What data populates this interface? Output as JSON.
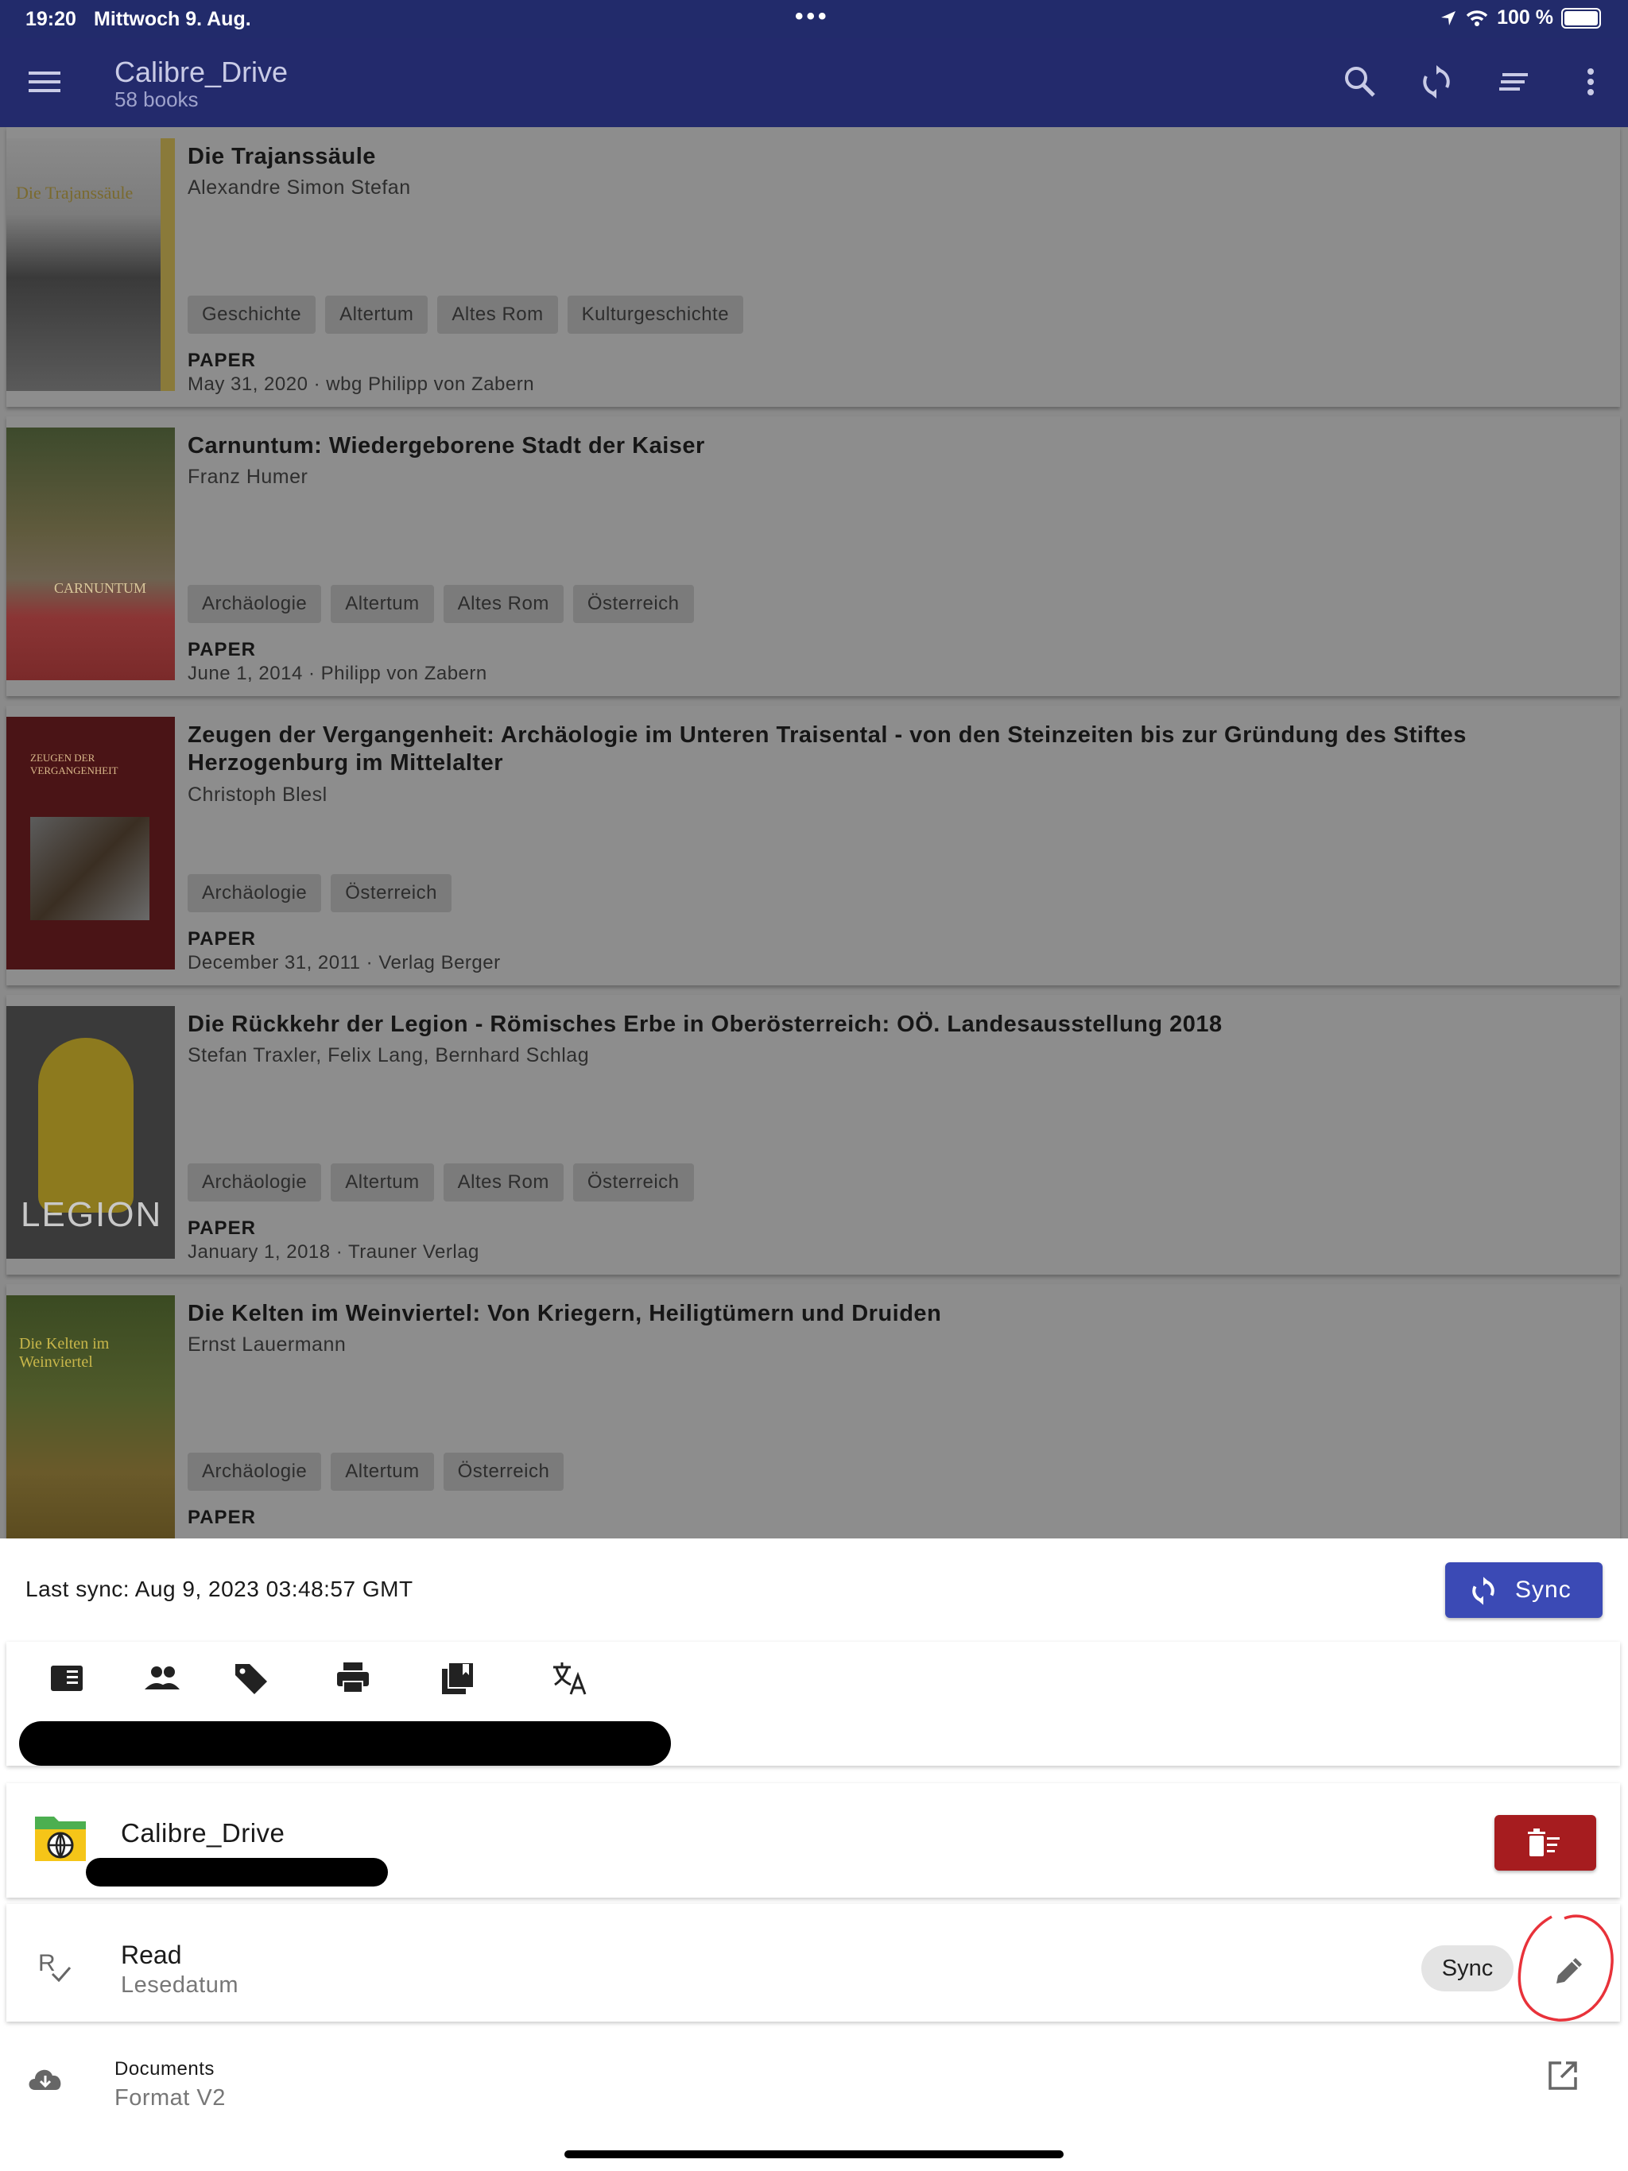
{
  "status_bar": {
    "time": "19:20",
    "date": "Mittwoch 9. Aug.",
    "battery": "100 %"
  },
  "app_bar": {
    "title": "Calibre_Drive",
    "subtitle": "58 books"
  },
  "books": [
    {
      "title": "Die Trajanssäule",
      "author": "Alexandre Simon Stefan",
      "tags": [
        "Geschichte",
        "Altertum",
        "Altes Rom",
        "Kulturgeschichte"
      ],
      "format": "PAPER",
      "published": "May 31, 2020 · wbg Philipp von Zabern",
      "cover_text": "Die Trajanssäule"
    },
    {
      "title": "Carnuntum: Wiedergeborene Stadt der Kaiser",
      "author": "Franz Humer",
      "tags": [
        "Archäologie",
        "Altertum",
        "Altes Rom",
        "Österreich"
      ],
      "format": "PAPER",
      "published": "June 1, 2014 · Philipp von Zabern",
      "cover_text": "CARNUNTUM"
    },
    {
      "title": "Zeugen der Vergangenheit: Archäologie im Unteren Traisental - von den Steinzeiten bis zur Gründung des Stiftes Herzogenburg im Mittelalter",
      "author": "Christoph Blesl",
      "tags": [
        "Archäologie",
        "Österreich"
      ],
      "format": "PAPER",
      "published": "December 31, 2011 · Verlag Berger",
      "cover_text": "ZEUGEN DER VERGANGENHEIT"
    },
    {
      "title": "Die Rückkehr der Legion - Römisches Erbe in Oberösterreich: OÖ. Landesausstellung 2018",
      "author": "Stefan Traxler, Felix Lang, Bernhard Schlag",
      "tags": [
        "Archäologie",
        "Altertum",
        "Altes Rom",
        "Österreich"
      ],
      "format": "PAPER",
      "published": "January 1, 2018 · Trauner Verlag",
      "cover_text": "LEGION"
    },
    {
      "title": "Die Kelten im Weinviertel: Von Kriegern, Heiligtümern und Druiden",
      "author": "Ernst Lauermann",
      "tags": [
        "Archäologie",
        "Altertum",
        "Österreich"
      ],
      "format": "PAPER",
      "published": "",
      "cover_text": "Die Kelten im Weinviertel"
    }
  ],
  "sheet": {
    "last_sync": "Last sync: Aug 9, 2023 03:48:57 GMT",
    "sync_button": "Sync",
    "icons": [
      "book-icon",
      "people-icon",
      "tag-icon",
      "printer-icon",
      "library-icon",
      "translate-icon"
    ],
    "library_name": "Calibre_Drive",
    "read_title": "Read",
    "read_subtitle": "Lesedatum",
    "read_chip": "Sync",
    "documents_title": "Documents",
    "documents_subtitle": "Format V2"
  },
  "colors": {
    "app_bar": "#232a6c",
    "sync_button": "#3b4ab5",
    "delete_button": "#a61c1f",
    "annotation": "#e8323a"
  }
}
